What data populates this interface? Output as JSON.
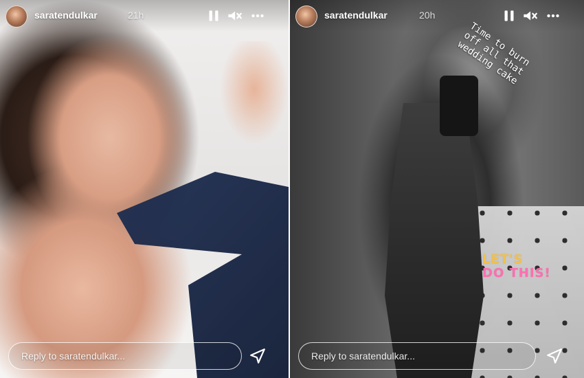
{
  "stories": [
    {
      "username": "saratendulkar",
      "time": "21h",
      "reply_placeholder": "Reply to saratendulkar...",
      "icons": {
        "avatar": "profile-avatar",
        "pause": "pause-icon",
        "mute": "mute-icon",
        "more": "more-icon",
        "send": "send-icon"
      }
    },
    {
      "username": "saratendulkar",
      "time": "20h",
      "caption": "Time to burn\noff all that\nwedding cake",
      "sticker_line1": "LET'S",
      "sticker_line2": "DO THIS!",
      "reply_placeholder": "Reply to saratendulkar...",
      "icons": {
        "avatar": "profile-avatar",
        "pause": "pause-icon",
        "mute": "mute-icon",
        "more": "more-icon",
        "send": "send-icon"
      }
    }
  ]
}
